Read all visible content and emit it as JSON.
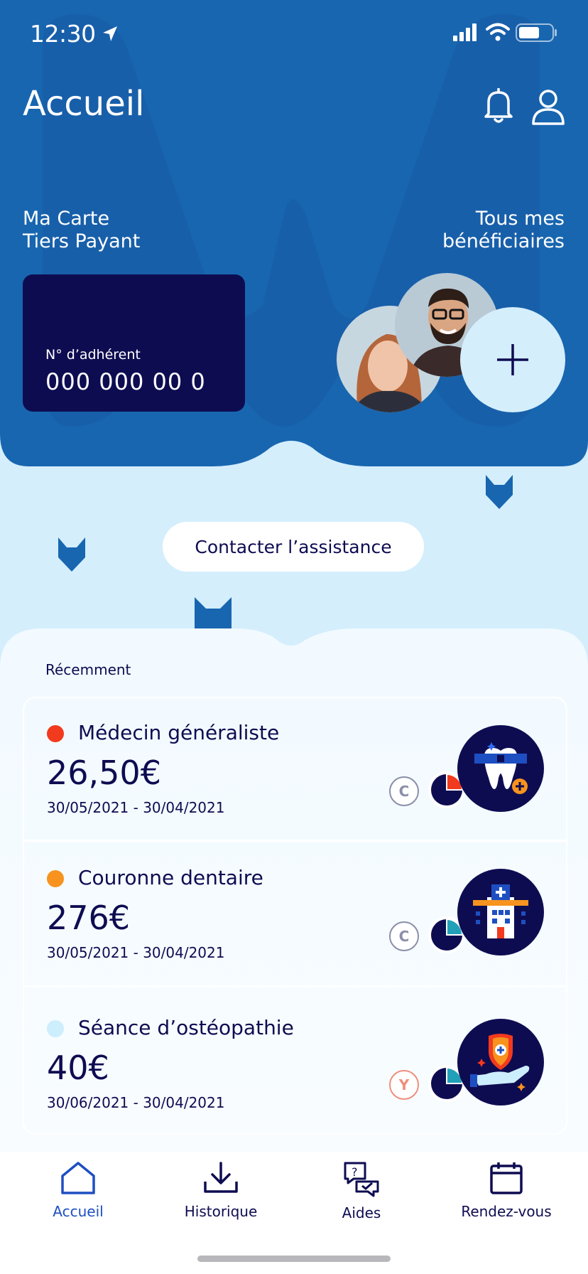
{
  "status_bar": {
    "time": "12:30"
  },
  "header": {
    "title": "Accueil",
    "card_section_title": "Ma Carte\nTiers Payant",
    "beneficiaries_title": "Tous mes\nbénéficiaires"
  },
  "card": {
    "member_number_label": "N° d’adhérent",
    "member_number": "000 000 00 0"
  },
  "contact_button": "Contacter l’assistance",
  "recent": {
    "label": "Récemment",
    "items": [
      {
        "title": "Médecin généraliste",
        "amount": "26,50€",
        "dates": "30/05/2021 - 30/04/2021",
        "status_color": "#f23a1e",
        "badge": "C",
        "badge_color": "#8a8fa8",
        "icon": "tooth-icon"
      },
      {
        "title": "Couronne dentaire",
        "amount": "276€",
        "dates": "30/05/2021 - 30/04/2021",
        "status_color": "#f7931e",
        "badge": "C",
        "badge_color": "#8a8fa8",
        "icon": "hospital-icon"
      },
      {
        "title": "Séance d’ostéopathie",
        "amount": "40€",
        "dates": "30/06/2021 - 30/04/2021",
        "status_color": "#cdeefd",
        "badge": "Y",
        "badge_color": "#ef8e7e",
        "icon": "care-shield-icon"
      }
    ]
  },
  "nav": {
    "items": [
      {
        "label": "Accueil",
        "icon": "home-icon",
        "active": true
      },
      {
        "label": "Historique",
        "icon": "download-icon",
        "active": false
      },
      {
        "label": "Aides",
        "icon": "help-chat-icon",
        "active": false
      },
      {
        "label": "Rendez-vous",
        "icon": "calendar-icon",
        "active": false
      }
    ]
  },
  "colors": {
    "brand_blue": "#1a65b0",
    "navy": "#0e0c51",
    "light_blue": "#d4eefc",
    "active_nav": "#1e4fc2"
  }
}
